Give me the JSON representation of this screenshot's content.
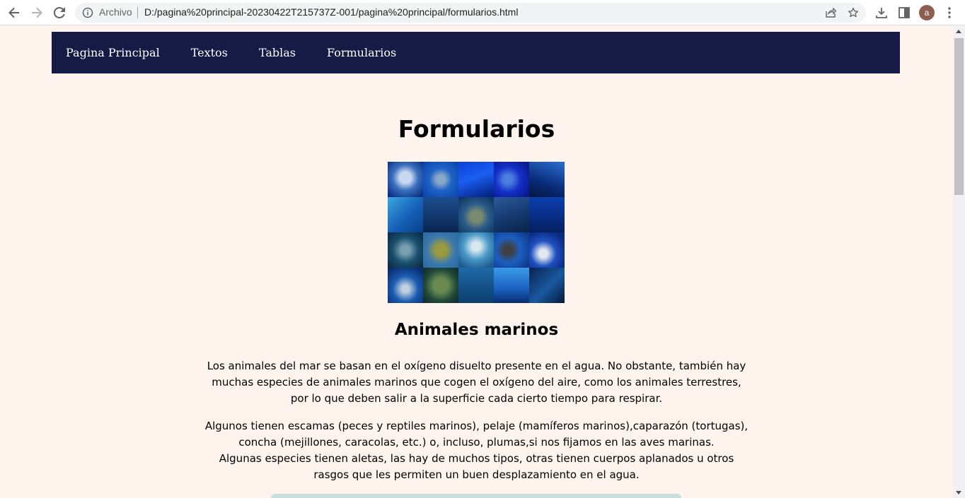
{
  "browser": {
    "scheme_label": "Archivo",
    "url": "D:/pagina%20principal-20230422T215737Z-001/pagina%20principal/formularios.html",
    "profile_initial": "a",
    "icons": [
      "back-arrow-icon",
      "forward-arrow-icon",
      "reload-icon",
      "info-icon",
      "share-icon",
      "star-icon",
      "download-icon",
      "side-panel-icon",
      "kebab-menu-icon"
    ]
  },
  "nav": {
    "items": [
      {
        "label": "Pagina Principal"
      },
      {
        "label": "Textos"
      },
      {
        "label": "Tablas"
      },
      {
        "label": "Formularios"
      }
    ]
  },
  "main": {
    "title": "Formularios",
    "subtitle": "Animales marinos",
    "paragraph1": [
      "Los animales del mar se basan en el oxígeno disuelto presente en el agua. No obstante, también hay",
      "muchas especies de animales marinos que cogen el oxígeno del aire, como los animales terrestres,",
      "por lo que deben salir a la superficie cada cierto tiempo para respirar."
    ],
    "paragraph2": [
      "Algunos tienen escamas (peces y reptiles marinos), pelaje (mamíferos marinos),caparazón (tortugas),",
      "concha (mejillones, caracolas, etc.) o, incluso, plumas,si nos fijamos en las aves marinas.",
      "Algunas especies tienen aletas, las hay de muchos tipos, otras tienen cuerpos aplanados u otros",
      "rasgos que les permiten un buen desplazamiento en el agua."
    ]
  },
  "colors": {
    "page_bg": "#fff3ee",
    "nav_bg": "#161b45",
    "nav_text": "#ffffff",
    "text": "#000000"
  }
}
